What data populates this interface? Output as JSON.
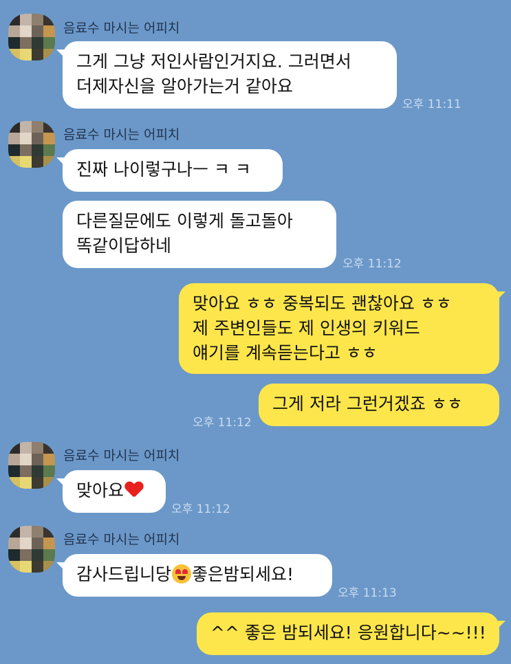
{
  "sender_name": "음료수 마시는 어피치",
  "messages": {
    "m1": {
      "lines": [
        "그게 그냥 저인사람인거지요. 그러면서",
        "더제자신을 알아가는거 같아요"
      ],
      "time": "오후 11:11"
    },
    "m2": {
      "lines": [
        "진짜 나이렇구나ㅡ ㅋ ㅋ"
      ]
    },
    "m3": {
      "lines": [
        "다른질문에도 이렇게 돌고돌아",
        "똑같이답하네"
      ],
      "time": "오후 11:12"
    },
    "m4": {
      "lines": [
        "맞아요 ㅎㅎ 중복되도 괜찮아요 ㅎㅎ",
        "제 주변인들도 제 인생의 키워드",
        "얘기를 계속듣는다고 ㅎㅎ"
      ]
    },
    "m5": {
      "text": "그게 저라 그런거겠죠 ㅎㅎ",
      "time": "오후 11:12"
    },
    "m6": {
      "text": "맞아요",
      "emoji": "heart-emoji",
      "time": "오후 11:12"
    },
    "m7": {
      "text_before": "감사드립니당",
      "emoji": "heart-eyes-emoji",
      "text_after": "좋은밤되세요!",
      "time": "오후 11:13"
    },
    "m8": {
      "text": "^^ 좋은 밤되세요! 응원합니다~~!!!"
    }
  },
  "colors": {
    "background": "#6b98c9",
    "incoming_bubble": "#ffffff",
    "outgoing_bubble": "#fde64b"
  }
}
